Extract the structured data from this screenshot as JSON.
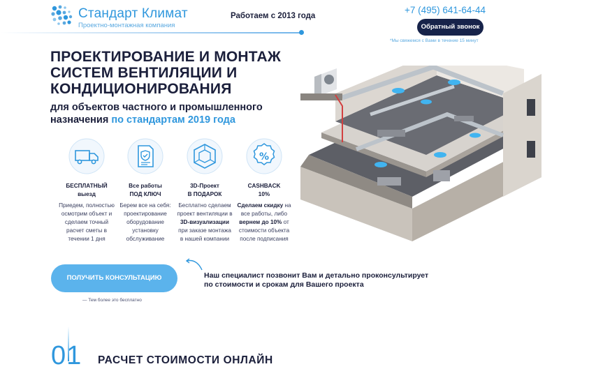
{
  "header": {
    "logo_name": "Стандарт Климат",
    "logo_sub": "Проектно-монтажная компания",
    "since": "Работаем с 2013 года",
    "phone": "+7 (495) 641-64-44",
    "callback_label": "Обратный звонок",
    "callback_note": "*Мы свяжемся с Вами в течение 15 минут"
  },
  "hero": {
    "title_lines": [
      "ПРОЕКТИРОВАНИЕ И МОНТАЖ",
      "СИСТЕМ ВЕНТИЛЯЦИИ И",
      "КОНДИЦИОНИРОВАНИЯ"
    ],
    "subtitle_line1": "для объектов частного и промышленного",
    "subtitle_line2": "назначения",
    "subtitle_accent": "по стандартам 2019 года"
  },
  "features": [
    {
      "icon": "truck-icon",
      "title_lines": [
        "БЕСПЛАТНЫЙ",
        "выезд"
      ],
      "desc_lines": [
        "Приедем, полностью",
        "осмотрим объект и",
        "сделаем точный",
        "расчет сметы в",
        "течении 1 дня"
      ]
    },
    {
      "icon": "document-shield-icon",
      "title_lines": [
        "Все работы",
        "ПОД КЛЮЧ"
      ],
      "desc_lines": [
        "Берем все на себя:",
        "проектирование",
        "оборудование",
        "установку",
        "обслуживание"
      ]
    },
    {
      "icon": "cube-3d-icon",
      "title_lines": [
        "3D-Проект",
        "В ПОДАРОК"
      ],
      "desc_pre": [
        "Бесплатно сделаем",
        "проект вентиляции в"
      ],
      "desc_bold": "3D-визуализации",
      "desc_post": [
        "при заказе монтажа",
        "в нашей компании"
      ]
    },
    {
      "icon": "percent-badge-icon",
      "title_lines": [
        "CASHBACK",
        "10%"
      ],
      "desc_bold1": "Сделаем скидку",
      "desc_mid1": " на",
      "desc_mid2": "все работы, либо",
      "desc_bold2": "вернем до 10%",
      "desc_mid3": " от",
      "desc_post": [
        "стоимости объекта",
        "после подписания"
      ]
    }
  ],
  "consult": {
    "button_label": "ПОЛУЧИТЬ КОНСУЛЬТАЦИЮ",
    "note": "— Тем более это бесплатно",
    "text_lines": [
      "Наш специалист позвонит Вам и детально проконсультирует",
      "по стоимости и срокам для Вашего проекта"
    ]
  },
  "section": {
    "number": "01",
    "title": "РАСЧЕТ СТОИМОСТИ ОНЛАЙН"
  },
  "colors": {
    "accent": "#2f97dd",
    "dark": "#1b1f3b",
    "button_dark": "#17234a",
    "button_light": "#5bb3ec"
  }
}
